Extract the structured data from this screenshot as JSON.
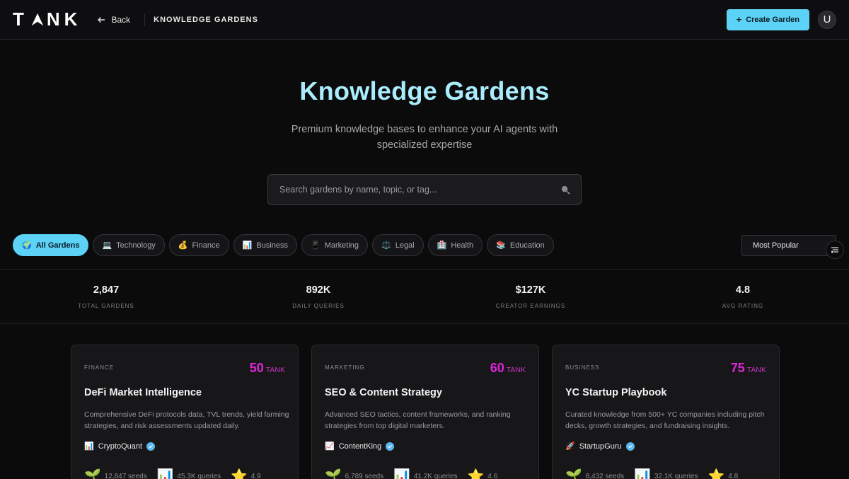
{
  "header": {
    "logo": "TANK",
    "back_label": "Back",
    "breadcrumb": "KNOWLEDGE GARDENS",
    "create_label": "Create Garden",
    "avatar_initial": "U"
  },
  "hero": {
    "title": "Knowledge Gardens",
    "subtitle": "Premium knowledge bases to enhance your AI agents with specialized expertise",
    "search_placeholder": "Search gardens by name, topic, or tag..."
  },
  "filters": {
    "chips": [
      {
        "icon": "🌍",
        "label": "All Gardens",
        "active": true
      },
      {
        "icon": "💻",
        "label": "Technology"
      },
      {
        "icon": "💰",
        "label": "Finance"
      },
      {
        "icon": "📊",
        "label": "Business"
      },
      {
        "icon": "📱",
        "label": "Marketing"
      },
      {
        "icon": "⚖️",
        "label": "Legal"
      },
      {
        "icon": "🏥",
        "label": "Health"
      },
      {
        "icon": "📚",
        "label": "Education"
      }
    ],
    "sort_value": "Most Popular"
  },
  "stats": [
    {
      "value": "2,847",
      "label": "TOTAL GARDENS"
    },
    {
      "value": "892K",
      "label": "DAILY QUERIES"
    },
    {
      "value": "$127K",
      "label": "CREATOR EARNINGS"
    },
    {
      "value": "4.8",
      "label": "AVG RATING"
    }
  ],
  "cards": [
    {
      "category": "FINANCE",
      "price": "50",
      "unit": "TANK",
      "title": "DeFi Market Intelligence",
      "description": "Comprehensive DeFi protocols data, TVL trends, yield farming strategies, and risk assessments updated daily.",
      "author_icon": "📊",
      "author": "CryptoQuant",
      "seeds": "12,847 seeds",
      "queries": "45.3K queries",
      "rating": "4.9"
    },
    {
      "category": "MARKETING",
      "price": "60",
      "unit": "TANK",
      "title": "SEO & Content Strategy",
      "description": "Advanced SEO tactics, content frameworks, and ranking strategies from top digital marketers.",
      "author_icon": "📈",
      "author": "ContentKing",
      "seeds": "6,789 seeds",
      "queries": "41.2K queries",
      "rating": "4.6"
    },
    {
      "category": "BUSINESS",
      "price": "75",
      "unit": "TANK",
      "title": "YC Startup Playbook",
      "description": "Curated knowledge from 500+ YC companies including pitch decks, growth strategies, and fundraising insights.",
      "author_icon": "🚀",
      "author": "StartupGuru",
      "seeds": "8,432 seeds",
      "queries": "32.1K queries",
      "rating": "4.8"
    }
  ],
  "colors": {
    "accent": "#5bd2f6",
    "price": "#e024d9",
    "title": "#a9ecfb"
  }
}
